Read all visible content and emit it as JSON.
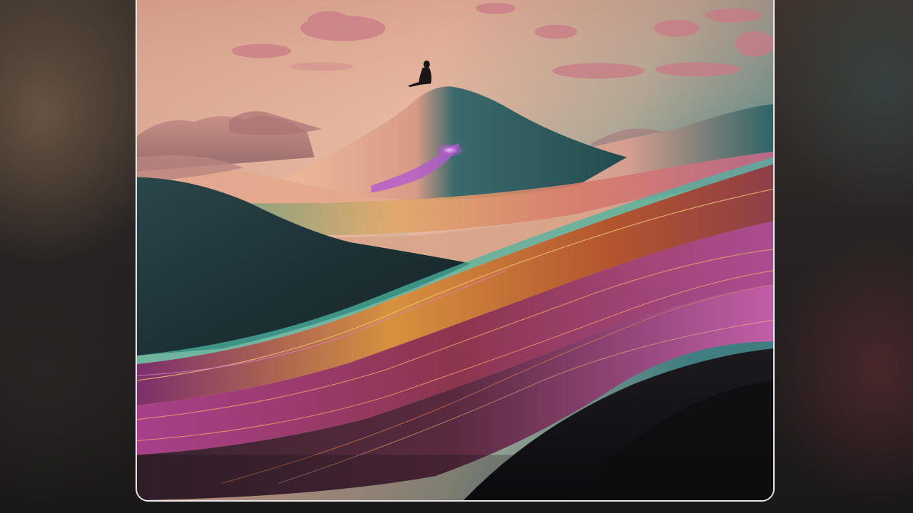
{
  "image": {
    "subject": "",
    "colors": {
      "sky_top": "#d9a38f",
      "sky_teal": "#4f8585",
      "dune_peach": "#e8b49a",
      "dune_teal": "#2c5a5c",
      "ribbon_magenta": "#b04fa0",
      "ribbon_gold": "#d9a24b",
      "ribbon_green": "#4fb39a",
      "shadow": "#0f0e12"
    }
  }
}
